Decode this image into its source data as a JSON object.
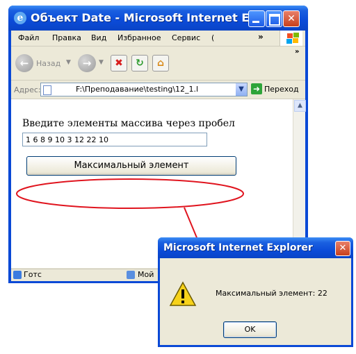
{
  "window": {
    "title": "Объект Date - Microsoft Internet E...",
    "controls": {
      "minimize": "",
      "maximize": "",
      "close": "✕"
    }
  },
  "menu": {
    "items": [
      "Файл",
      "Правка",
      "Вид",
      "Избранное",
      "Сервис",
      "("
    ],
    "overflow": "»"
  },
  "toolbar": {
    "back_label": "Назад",
    "overflow": "»"
  },
  "address": {
    "label": "Адрес:",
    "url": "F:\\Преподавание\\testing\\12_1.l",
    "go_label": "Переход"
  },
  "page": {
    "prompt": "Введите элементы массива через пробел",
    "input_value": "1 6 8 9 10 3 12 22 10",
    "button_label": "Максимальный элемент"
  },
  "status": {
    "text": "Готс",
    "zone": "Мой"
  },
  "dialog": {
    "title": "Microsoft Internet Explorer",
    "message": "Максимальный элемент: 22",
    "ok_label": "OK",
    "close": "✕"
  },
  "colors": {
    "titlebar": "#0b4bd8",
    "annotation": "#e0141e"
  }
}
